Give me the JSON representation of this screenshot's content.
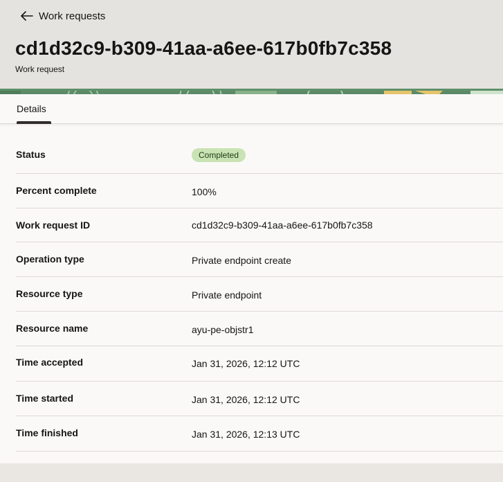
{
  "header": {
    "back_label": "Work requests",
    "title": "cd1d32c9-b309-41aa-a6ee-617b0fb7c358",
    "subtitle": "Work request"
  },
  "tabs": [
    {
      "label": "Details",
      "active": true
    }
  ],
  "details": [
    {
      "label": "Status",
      "value": "Completed",
      "badge_color": "#c9e3b4"
    },
    {
      "label": "Percent complete",
      "value": "100%"
    },
    {
      "label": "Work request ID",
      "value": "cd1d32c9-b309-41aa-a6ee-617b0fb7c358"
    },
    {
      "label": "Operation type",
      "value": "Private endpoint create"
    },
    {
      "label": "Resource type",
      "value": "Private endpoint"
    },
    {
      "label": "Resource name",
      "value": "ayu-pe-objstr1"
    },
    {
      "label": "Time accepted",
      "value": "Jan 31, 2026, 12:12 UTC"
    },
    {
      "label": "Time started",
      "value": "Jan 31, 2026, 12:12 UTC"
    },
    {
      "label": "Time finished",
      "value": "Jan 31, 2026, 12:13 UTC"
    }
  ],
  "icons": {
    "back": "arrow-left-icon"
  }
}
